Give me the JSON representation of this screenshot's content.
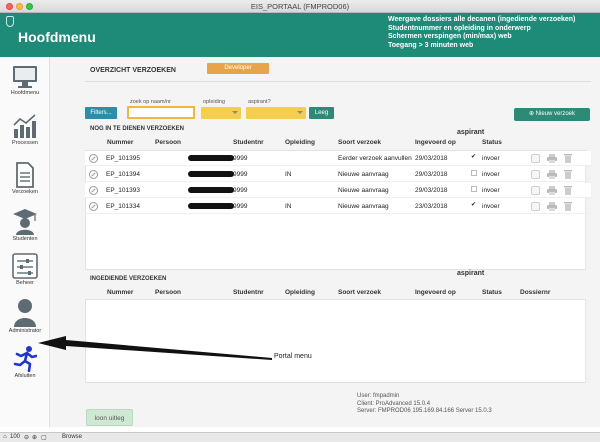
{
  "window": {
    "title": "EIS_PORTAAL (FMPROD06)"
  },
  "header": {
    "title": "Hoofdmenu",
    "info_lines": [
      "Weergave dossiers alle decanen (ingediende verzoeken)",
      "Studentnummer en opleiding in onderwerp",
      "Schermen verspingen (min/max) web",
      "Toegang > 3 minuten web"
    ]
  },
  "sidebar": {
    "items": [
      {
        "label": "Hoofdmenu",
        "icon": "monitor-icon"
      },
      {
        "label": "Processen",
        "icon": "chart-icon"
      },
      {
        "label": "Verzoeken",
        "icon": "document-icon"
      },
      {
        "label": "Studenten",
        "icon": "graduation-cap-icon"
      },
      {
        "label": "Beheer",
        "icon": "sliders-icon"
      },
      {
        "label": "Administrator",
        "icon": "user-icon"
      },
      {
        "label": "Afsluiten",
        "icon": "running-man-icon"
      }
    ]
  },
  "main": {
    "section_title": "OVERZICHT VERZOEKEN",
    "developer_label": "Developer",
    "search": {
      "naam_label": "zoek op naam/nr",
      "opleiding_label": "opleiding",
      "aspirant_label": "aspirant?",
      "filters_label": "Filters...",
      "leeg_label": "Leeg",
      "naam_value": ""
    },
    "new_request_label": "Nieuw verzoek",
    "pending": {
      "title": "NOG IN TE DIENEN VERZOEKEN",
      "aspirant_header": "aspirant",
      "columns": [
        "Nummer",
        "Persoon",
        "Studentnr",
        "Opleiding",
        "Soort verzoek",
        "Ingevoerd op",
        "Status"
      ],
      "rows": [
        {
          "nummer": "EP_101395",
          "studentnr": "9999",
          "opleiding": "",
          "soort": "Eerder verzoek aanvullen",
          "ingevoerd": "29/03/2018",
          "aspirant": true,
          "status": "invoer"
        },
        {
          "nummer": "EP_101394",
          "studentnr": "9999",
          "opleiding": "IN",
          "soort": "Nieuwe aanvraag",
          "ingevoerd": "29/03/2018",
          "aspirant": false,
          "status": "invoer"
        },
        {
          "nummer": "EP_101393",
          "studentnr": "9999",
          "opleiding": "",
          "soort": "Nieuwe aanvraag",
          "ingevoerd": "29/03/2018",
          "aspirant": false,
          "status": "invoer"
        },
        {
          "nummer": "EP_101334",
          "studentnr": "9999",
          "opleiding": "IN",
          "soort": "Nieuwe aanvraag",
          "ingevoerd": "23/03/2018",
          "aspirant": true,
          "status": "invoer"
        }
      ]
    },
    "submitted": {
      "title": "INGEDIENDE VERZOEKEN",
      "aspirant_header": "aspirant",
      "columns": [
        "Nummer",
        "Persoon",
        "Studentnr",
        "Opleiding",
        "Soort verzoek",
        "Ingevoerd op",
        "Status",
        "Dossiernr"
      ]
    },
    "annotation": "Portal menu",
    "user_info": [
      "User: fmpadmin",
      "Client: ProAdvanced 15.0.4",
      "Server: FMPROD06 195.169.84.166 Server 15.0.3"
    ],
    "loon_label": "loon uitleg"
  },
  "statusbar": {
    "zoom": "100",
    "mode": "Browse"
  },
  "colors": {
    "header": "#1e8a78",
    "accent_green": "#2c8a77",
    "filters_blue": "#2f8cab",
    "developer_orange": "#e8a44a",
    "dropdown_yellow": "#f4cf4b"
  }
}
